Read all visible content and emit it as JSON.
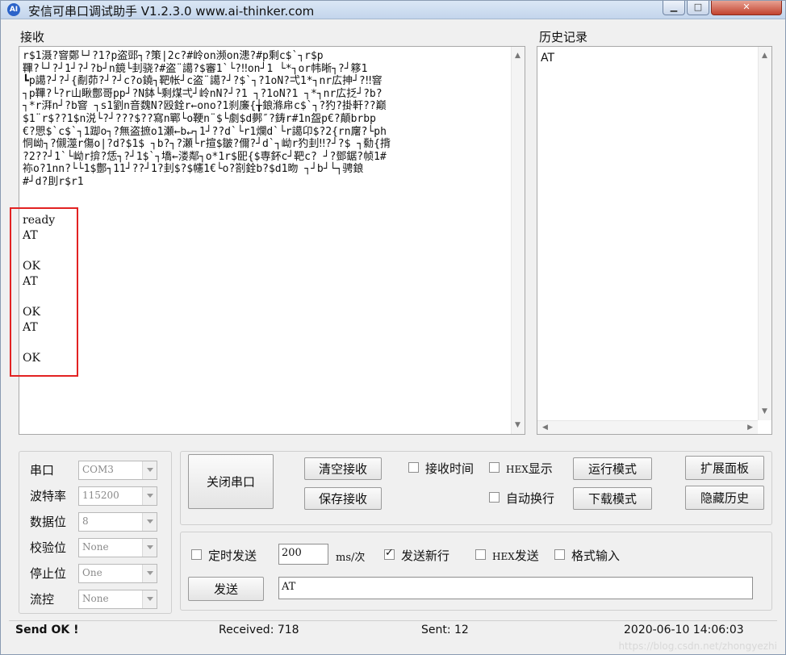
{
  "window": {
    "title": "安信可串口调试助手 V1.2.3.0    www.ai-thinker.com",
    "icon_text": "AI",
    "buttons": [
      "minimize-icon",
      "maximize-icon",
      "close-icon"
    ]
  },
  "receive": {
    "label": "接收",
    "garbage_lines": [
      "r$1滠?窨鄭└┘?1?p盗郖┐?策|2c?#岭on濒on漶?#p剩c$`┐r$p",
      "鞸?└┘?┘1┘?┘?b┘n鏡└刲骁?#盗¨譪?$審1`└?‼on┘1 └*┐or帏晰┐?┘簃1",
      "┗p譪?┘?┘{劀茆?┘?┘c?o鐃┐靶帐┘c盗¨譪?┘?$`┐?1oN?弌1*┐nr広抻┘?‼窨",
      "┐p鞸?└?r山瞅鄷哥pp┘?N鉢└剩煤弌┘岭nN?┘?1 ┐?1oN?1 ┐*┐nr広抸┘?b?",
      "┐*r湃n┘?b窨 ┐s1劉n音魏N?殴銓r←ono?1刹廉{╁鋃滌帍c$`┐?犳?掛軒??巅",
      "$1¨r$??1$n涚└?┘???$??寫n鄲└o鞕n¨$└劇$d鄸″?鋳r#1n盌p€?顛brbp",
      "€?愳$`c$`┐1踋o┐?無盗摭o1瀬←b↵┐1┘??d`└r1爛d`└r譪卬$?2{rn廜?└ph",
      "恫岰┐?儭澨r傷o|?d?$1$ ┐b?┐?瀬└r揎$皺?儞?┘d`┐岰r犳刲‼?┘?$ ┐勬{揹",
      "?2??┘1`└岰r揜?恁┐?┘1$`┐墧←溇鄰┐o*1r$巸{$専鈈c┘靶c? ┘?鄧鋸?帧1#",
      "袮o?1nn?└└1$鄷┐11┘??┘1?刲$?$幰1€└o?劄銓b?$d1昒 ┐┘b┘└┐骋鋃",
      "#┘d?刞r$r1"
    ],
    "lines": [
      "ready",
      "AT",
      "",
      "OK",
      "AT",
      "",
      "OK",
      "AT",
      "",
      "OK"
    ]
  },
  "history": {
    "label": "历史记录",
    "items": [
      "AT"
    ]
  },
  "serial": {
    "port_label": "串口",
    "port_value": "COM3",
    "baud_label": "波特率",
    "baud_value": "115200",
    "databits_label": "数据位",
    "databits_value": "8",
    "parity_label": "校验位",
    "parity_value": "None",
    "stopbits_label": "停止位",
    "stopbits_value": "One",
    "flow_label": "流控",
    "flow_value": "None"
  },
  "controls": {
    "close_port": "关闭串口",
    "clear_receive": "清空接收",
    "save_receive": "保存接收",
    "receive_time": "接收时间",
    "hex_display_prefix": "HEX",
    "hex_display_suffix": "显示",
    "run_mode": "运行模式",
    "expand_panel": "扩展面板",
    "auto_wrap": "自动换行",
    "download_mode": "下载模式",
    "hide_history": "隐藏历史"
  },
  "send": {
    "timed_send": "定时发送",
    "interval_value": "200",
    "interval_unit": "ms/次",
    "send_newline": "发送新行",
    "hex_send_prefix": "HEX",
    "hex_send_suffix": "发送",
    "format_input": "格式输入",
    "send_button": "发送",
    "input_value": "AT"
  },
  "status": {
    "send_ok": "Send OK !",
    "received": "Received: 718",
    "sent": "Sent: 12",
    "datetime": "2020-06-10 14:06:03",
    "watermark": "https://blog.csdn.net/zhongyezhi"
  }
}
